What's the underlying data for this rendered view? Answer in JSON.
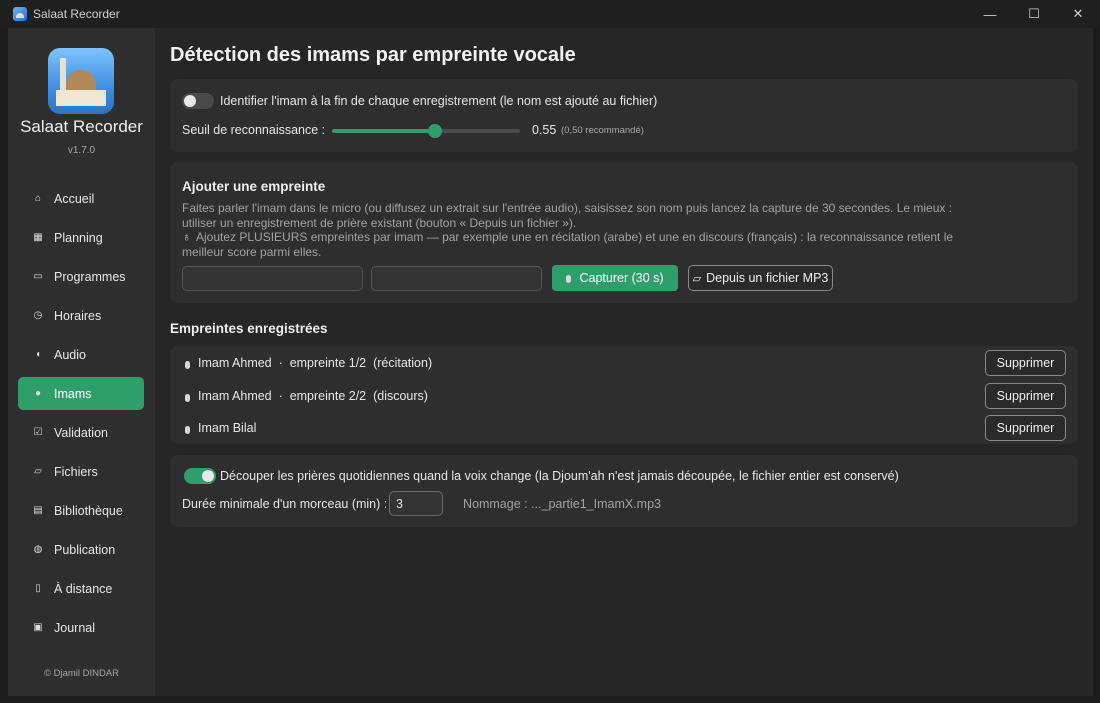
{
  "window": {
    "title": "Salaat Recorder",
    "controls": {
      "minimize": "—",
      "maximize": "☐",
      "close": "✕"
    }
  },
  "sidebar": {
    "app_name": "Salaat Recorder",
    "version": "v1.7.0",
    "items": [
      {
        "label": "Accueil",
        "icon": "home-icon",
        "glyph": "⌂"
      },
      {
        "label": "Planning",
        "icon": "calendar-icon",
        "glyph": "▦"
      },
      {
        "label": "Programmes",
        "icon": "radio-icon",
        "glyph": "▭"
      },
      {
        "label": "Horaires",
        "icon": "clock-icon",
        "glyph": "◷"
      },
      {
        "label": "Audio",
        "icon": "speaker-icon",
        "glyph": "◖"
      },
      {
        "label": "Imams",
        "icon": "microphone-icon",
        "glyph": "●"
      },
      {
        "label": "Validation",
        "icon": "checkbox-icon",
        "glyph": "☑"
      },
      {
        "label": "Fichiers",
        "icon": "folder-icon",
        "glyph": "▱"
      },
      {
        "label": "Bibliothèque",
        "icon": "books-icon",
        "glyph": "▤"
      },
      {
        "label": "Publication",
        "icon": "globe-icon",
        "glyph": "◍"
      },
      {
        "label": "À distance",
        "icon": "phone-icon",
        "glyph": "▯"
      },
      {
        "label": "Journal",
        "icon": "clipboard-icon",
        "glyph": "▣"
      }
    ],
    "active_index": 5,
    "copyright": "© Djamil DINDAR"
  },
  "main": {
    "title": "Détection des imams par empreinte vocale",
    "identify": {
      "toggle_on": false,
      "label": "Identifier l'imam à la fin de chaque enregistrement (le nom est ajouté au fichier)",
      "threshold_label": "Seuil de reconnaissance :",
      "threshold_value": 0.55,
      "threshold_display": "0.55",
      "threshold_hint": "(0,50 recommandé)"
    },
    "add_print": {
      "heading": "Ajouter une empreinte",
      "description": "Faites parler l'imam dans le micro (ou diffusez un extrait sur l'entrée audio), saisissez son nom puis lancez la capture de 30 secondes. Le mieux : utiliser un enregistrement de prière existant (bouton « Depuis un fichier »).",
      "tip": "Ajoutez PLUSIEURS empreintes par imam — par exemple une en récitation (arabe) et une en discours (français) : la reconnaissance retient le meilleur score parmi elles.",
      "name_value": "",
      "label_value": "",
      "capture_button": "Capturer (30 s)",
      "file_button": "Depuis un fichier MP3"
    },
    "registered": {
      "heading": "Empreintes enregistrées",
      "delete_label": "Supprimer",
      "items": [
        "Imam Ahmed  ·  empreinte 1/2  (récitation)",
        "Imam Ahmed  ·  empreinte 2/2  (discours)",
        "Imam Bilal"
      ]
    },
    "split": {
      "toggle_on": true,
      "label": "Découper les prières quotidiennes quand la voix change (la Djoum'ah n'est jamais découpée, le fichier entier est conservé)",
      "min_duration_label": "Durée minimale d'un morceau (min) :",
      "min_duration_value": "3",
      "naming": "Nommage : ..._partie1_ImamX.mp3"
    }
  }
}
